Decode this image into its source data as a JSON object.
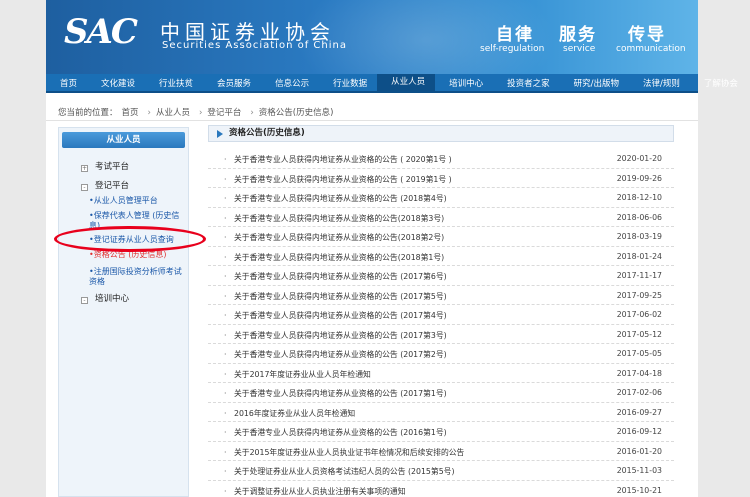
{
  "header": {
    "logo": "SAC",
    "brand_cn": "中国证券业协会",
    "brand_en": "Securities Association of China",
    "mottos": [
      {
        "cn": "自律",
        "en": "self-regulation"
      },
      {
        "cn": "服务",
        "en": "service"
      },
      {
        "cn": "传导",
        "en": "communication"
      }
    ]
  },
  "nav": [
    "首页",
    "文化建设",
    "行业扶贫",
    "会员服务",
    "信息公示",
    "行业数据",
    "从业人员",
    "培训中心",
    "投资者之家",
    "研究/出版物",
    "法律/规则",
    "了解协会"
  ],
  "breadcrumb": {
    "prefix": "您当前的位置：",
    "items": [
      "首页",
      "从业人员",
      "登记平台",
      "资格公告(历史信息)"
    ]
  },
  "sidebar": {
    "title": "从业人员",
    "nodes": [
      {
        "label": "考试平台",
        "box": "+"
      },
      {
        "label": "登记平台",
        "box": "-"
      },
      {
        "label": "培训中心",
        "box": "-"
      }
    ],
    "leaves": [
      "•从业人员管理平台",
      "•保荐代表人管理 (历史信息)",
      "•登记证券从业人员查询",
      "•资格公告 (历史信息)",
      "•注册国际投资分析师考试资格"
    ]
  },
  "main": {
    "title": "资格公告(历史信息)",
    "rows": [
      {
        "title": "关于香港专业人员获得内地证券从业资格的公告 ( 2020第1号 )",
        "date": "2020-01-20"
      },
      {
        "title": "关于香港专业人员获得内地证券从业资格的公告 ( 2019第1号 )",
        "date": "2019-09-26"
      },
      {
        "title": "关于香港专业人员获得内地证券从业资格的公告 (2018第4号)",
        "date": "2018-12-10"
      },
      {
        "title": "关于香港专业人员获得内地证券从业资格的公告(2018第3号)",
        "date": "2018-06-06"
      },
      {
        "title": "关于香港专业人员获得内地证券从业资格的公告(2018第2号)",
        "date": "2018-03-19"
      },
      {
        "title": "关于香港专业人员获得内地证券从业资格的公告(2018第1号)",
        "date": "2018-01-24"
      },
      {
        "title": "关于香港专业人员获得内地证券从业资格的公告 (2017第6号)",
        "date": "2017-11-17"
      },
      {
        "title": "关于香港专业人员获得内地证券从业资格的公告 (2017第5号)",
        "date": "2017-09-25"
      },
      {
        "title": "关于香港专业人员获得内地证券从业资格的公告 (2017第4号)",
        "date": "2017-06-02"
      },
      {
        "title": "关于香港专业人员获得内地证券从业资格的公告 (2017第3号)",
        "date": "2017-05-12"
      },
      {
        "title": "关于香港专业人员获得内地证券从业资格的公告 (2017第2号)",
        "date": "2017-05-05"
      },
      {
        "title": "关于2017年度证券业从业人员年检通知",
        "date": "2017-04-18"
      },
      {
        "title": "关于香港专业人员获得内地证券从业资格的公告 (2017第1号)",
        "date": "2017-02-06"
      },
      {
        "title": "2016年度证券业从业人员年检通知",
        "date": "2016-09-27"
      },
      {
        "title": "关于香港专业人员获得内地证券从业资格的公告 (2016第1号)",
        "date": "2016-09-12"
      },
      {
        "title": "关于2015年度证券业从业人员执业证书年检情况和后续安排的公告",
        "date": "2016-01-20"
      },
      {
        "title": "关于处理证券业从业人员资格考试违纪人员的公告 (2015第5号)",
        "date": "2015-11-03"
      },
      {
        "title": "关于调整证券业从业人员执业注册有关事项的通知",
        "date": "2015-10-21"
      }
    ]
  }
}
